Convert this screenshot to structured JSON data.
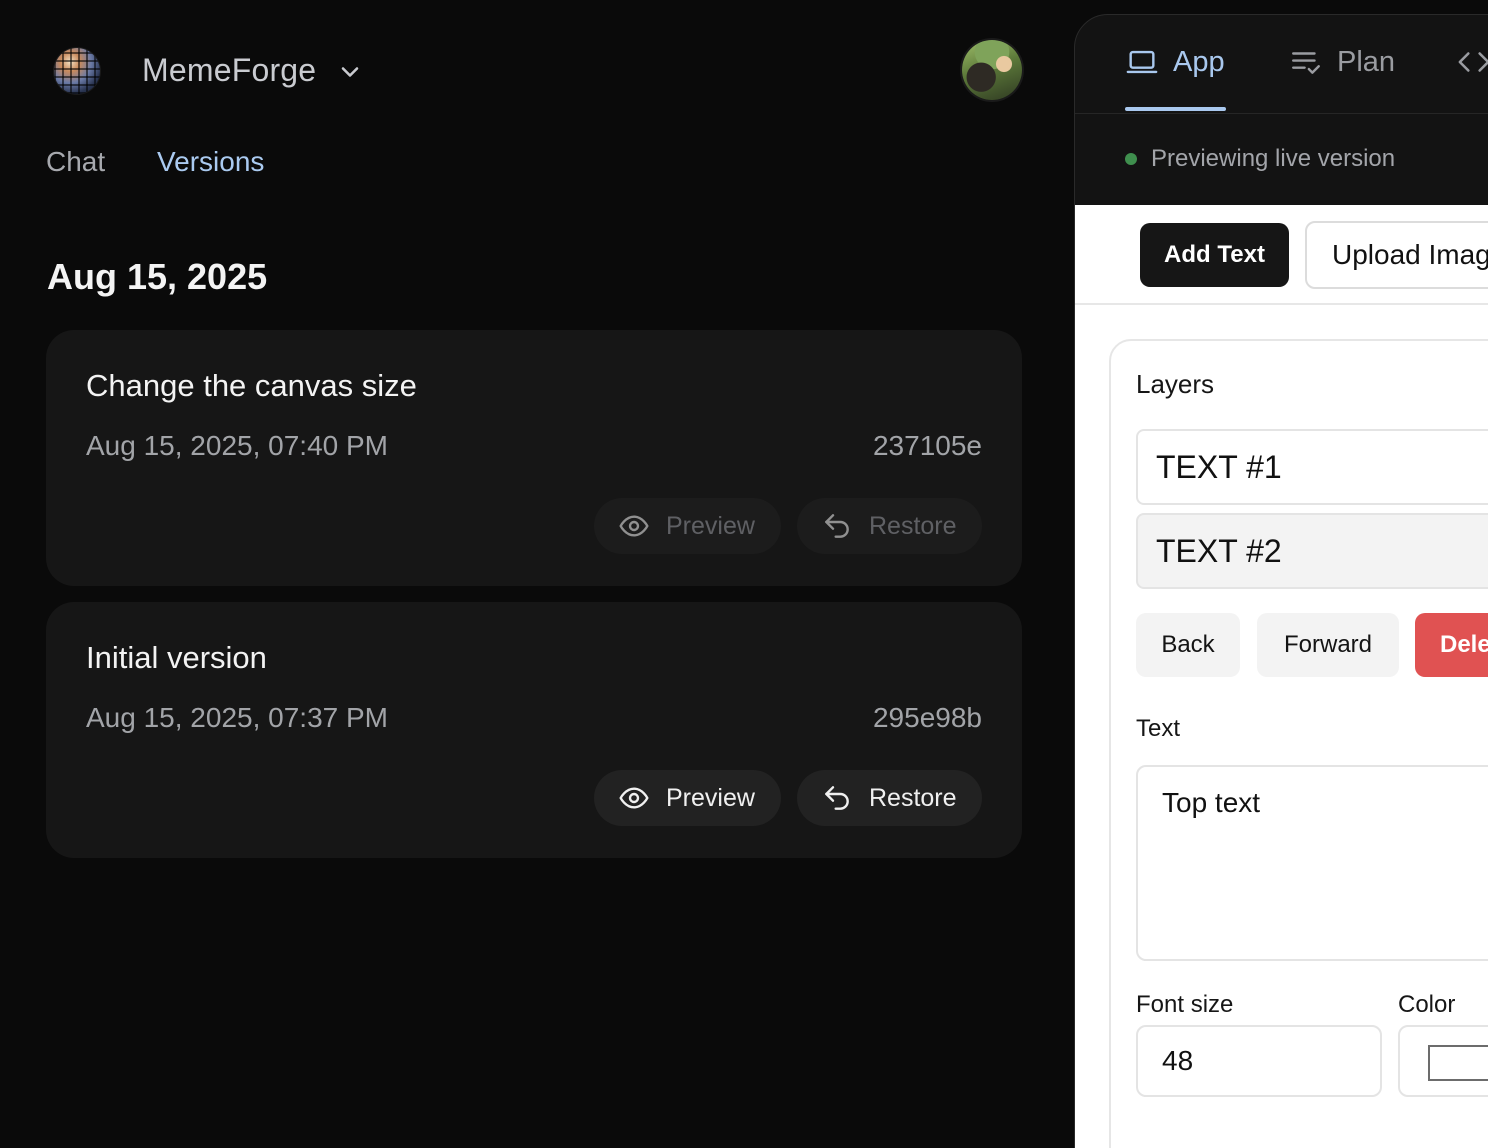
{
  "app": {
    "name": "MemeForge"
  },
  "nav_tabs": {
    "chat": "Chat",
    "versions": "Versions"
  },
  "versions": {
    "date_heading": "Aug 15, 2025",
    "items": [
      {
        "title": "Change the canvas size",
        "timestamp": "Aug 15, 2025, 07:40 PM",
        "hash": "237105e",
        "preview_label": "Preview",
        "restore_label": "Restore",
        "actions_enabled": false
      },
      {
        "title": "Initial version",
        "timestamp": "Aug 15, 2025, 07:37 PM",
        "hash": "295e98b",
        "preview_label": "Preview",
        "restore_label": "Restore",
        "actions_enabled": true
      }
    ]
  },
  "preview_pane": {
    "tabs": {
      "app": "App",
      "plan": "Plan"
    },
    "active_tab": "App",
    "status": "Previewing live version",
    "status_color": "#3f8f4e"
  },
  "editor": {
    "toolbar": {
      "add_text": "Add Text",
      "upload_image": "Upload Imag"
    },
    "layers_label": "Layers",
    "layers": [
      "TEXT #1",
      "TEXT #2"
    ],
    "selected_layer": "TEXT #2",
    "order_buttons": {
      "back": "Back",
      "forward": "Forward",
      "delete": "Dele"
    },
    "text_label": "Text",
    "text_value": "Top text",
    "font_size_label": "Font size",
    "font_size_value": "48",
    "color_label": "Color",
    "color_value": "#ffffff"
  },
  "icons": {
    "logo": "disco-ball-logo",
    "app_switcher": "chevron-down-icon",
    "preview": "eye-icon",
    "restore": "undo-arrow-icon",
    "app_tab": "laptop-icon",
    "plan_tab": "list-check-icon",
    "code_tab": "code-brackets-icon"
  },
  "colors": {
    "accent": "#aacaf0",
    "delete": "#e05252"
  }
}
